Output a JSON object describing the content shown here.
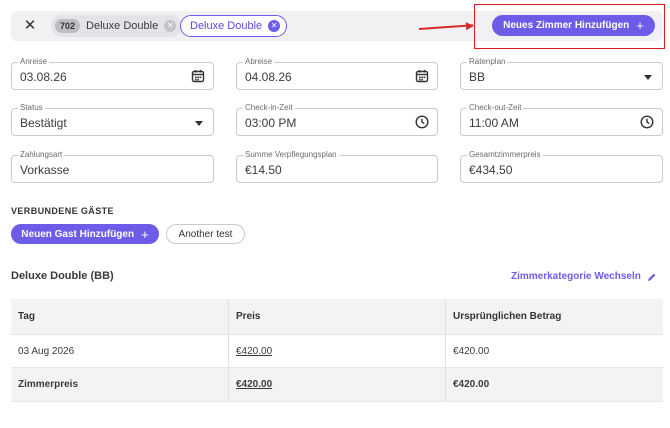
{
  "tabs": {
    "room_number": "702",
    "room_tab_label": "Deluxe Double",
    "active_tab_label": "Deluxe Double"
  },
  "add_room_button": {
    "label": "Neues Zimmer Hinzufügen",
    "icon": "plus-icon"
  },
  "fields": {
    "arrival": {
      "label": "Anreise",
      "value": "03.08.26"
    },
    "departure": {
      "label": "Abreise",
      "value": "04.08.26"
    },
    "rate_plan": {
      "label": "Ratenplan",
      "value": "BB"
    },
    "status": {
      "label": "Status",
      "value": "Bestätigt"
    },
    "checkin": {
      "label": "Check-in-Zeit",
      "value": "03:00 PM"
    },
    "checkout": {
      "label": "Check-out-Zeit",
      "value": "11:00 AM"
    },
    "payment": {
      "label": "Zahlungsart",
      "value": "Vorkasse"
    },
    "meal_sum": {
      "label": "Summe Verpflegungsplan",
      "value": "€14.50"
    },
    "total_room_price": {
      "label": "Gesamtzimmerpreis",
      "value": "€434.50"
    }
  },
  "guests": {
    "section_title": "VERBUNDENE GÄSTE",
    "add_guest_label": "Neuen Gast Hinzufügen",
    "guest_names": [
      "Another test"
    ]
  },
  "room": {
    "title": "Deluxe Double (BB)",
    "change_category_label": "Zimmerkategorie Wechseln"
  },
  "table": {
    "headers": [
      "Tag",
      "Preis",
      "Ursprünglichen Betrag"
    ],
    "rows": [
      [
        "03 Aug 2026",
        "€420.00",
        "€420.00"
      ]
    ],
    "footer": [
      "Zimmerpreis",
      "€420.00",
      "€420.00"
    ]
  },
  "colors": {
    "accent": "#6c5ce7",
    "annotation_red": "#e01b24"
  }
}
